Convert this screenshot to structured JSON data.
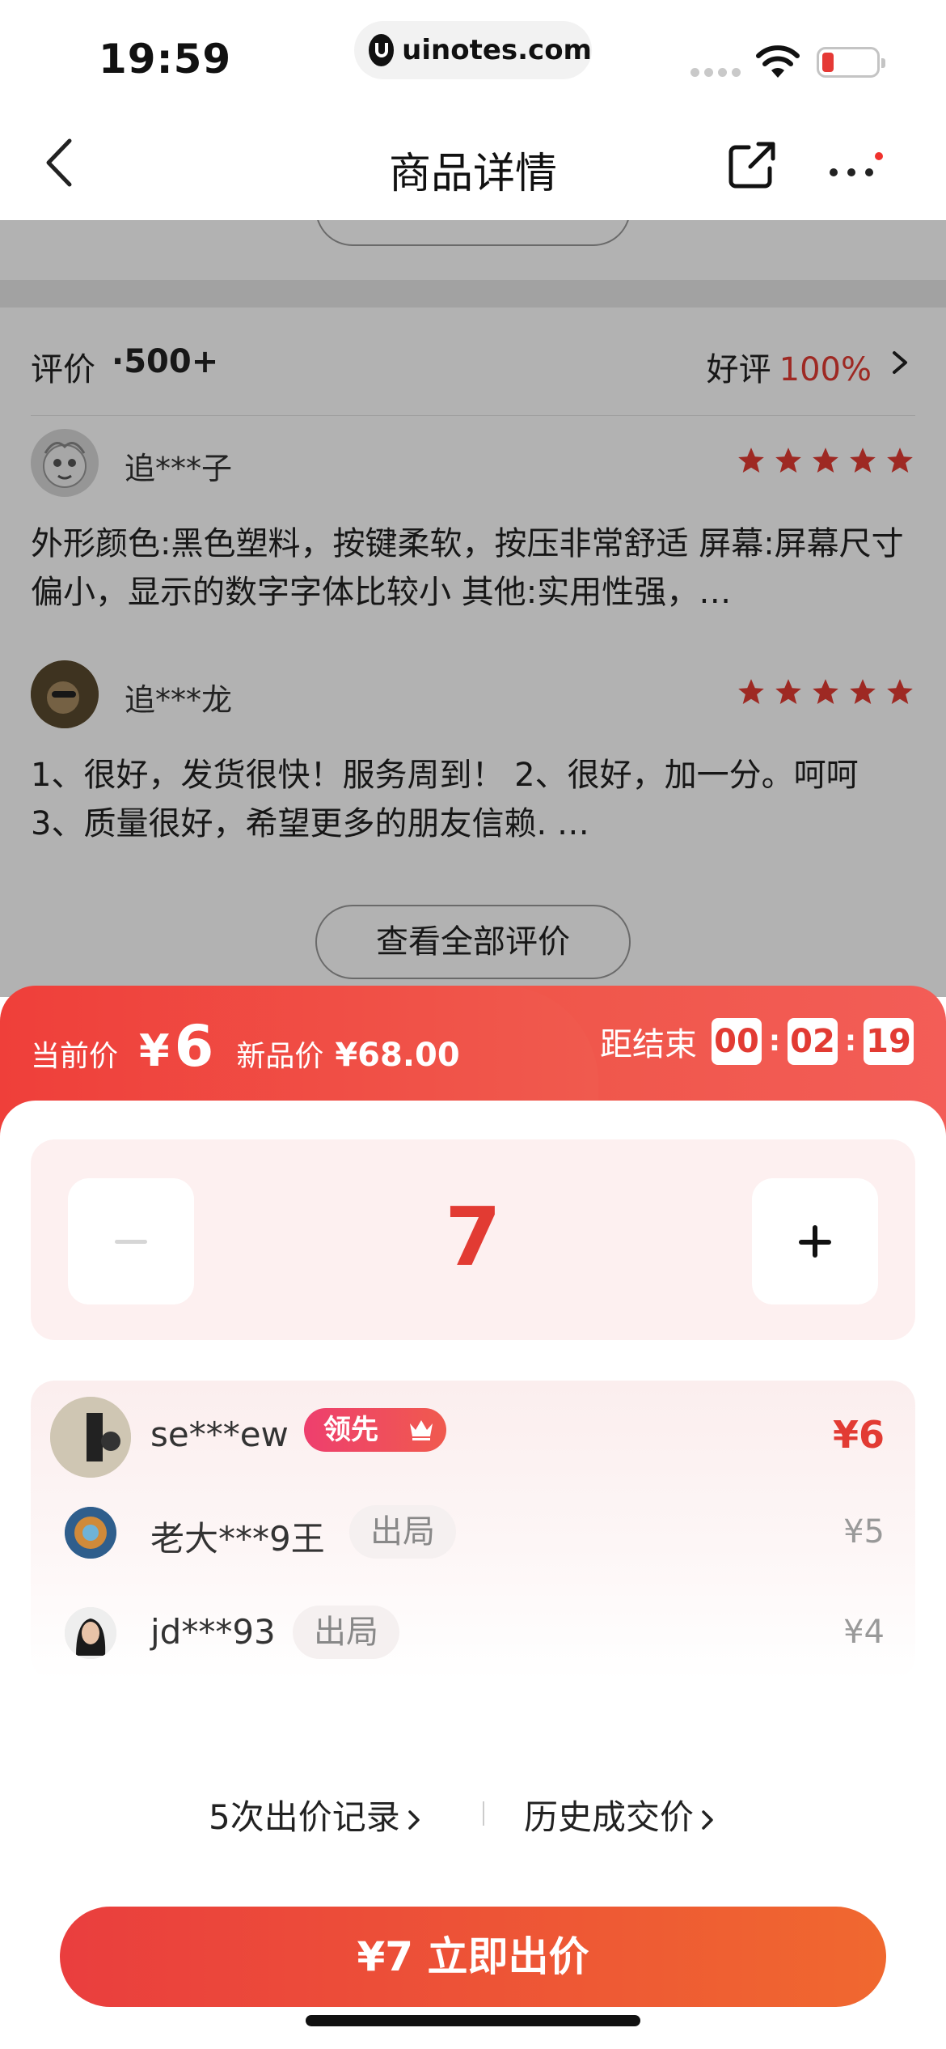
{
  "status_bar": {
    "time": "19:59",
    "url": "uinotes.com"
  },
  "nav": {
    "title": "商品详情",
    "back_icon": "chevron-left-icon",
    "share_icon": "share-icon",
    "more_icon": "more-dots-icon"
  },
  "background": {
    "reviews_header": {
      "label": "评价",
      "count": "·500+",
      "good_label": "好评",
      "good_rate": "100%"
    },
    "reviews": [
      {
        "user": "追***子",
        "stars": 5,
        "text": "外形颜色:黑色塑料，按键柔软，按压非常舒适 屏幕:屏幕尺寸偏小，显示的数字字体比较小 其他:实用性强，…"
      },
      {
        "user": "追***龙",
        "stars": 5,
        "text": "1、很好，发货很快！服务周到！        2、很好，加一分。呵呵       3、质量很好，希望更多的朋友信赖.   …"
      }
    ],
    "all_reviews_button": "查看全部评价",
    "colors": {
      "star": "#e23b33",
      "accent": "#e23b33"
    }
  },
  "bid_sheet": {
    "current_price_label": "当前价",
    "currency": "¥",
    "current_price": "6",
    "new_price_label": "新品价",
    "new_price": "¥68.00",
    "countdown_label": "距结束",
    "countdown": {
      "h": "00",
      "m": "02",
      "s": "19"
    },
    "stepper": {
      "value": "7",
      "minus_icon": "minus-icon",
      "plus_icon": "plus-icon"
    },
    "bids": [
      {
        "user": "se***ew",
        "badge": "领先",
        "badge_icon": "crown-icon",
        "amount": "¥6"
      },
      {
        "user": "老大***9王",
        "badge": "出局",
        "amount": "¥5"
      },
      {
        "user": "jd***93",
        "badge": "出局",
        "amount": "¥4"
      }
    ],
    "bid_records_link": "5次出价记录",
    "history_price_link": "历史成交价",
    "submit_button": "¥7 立即出价",
    "colors": {
      "header_gradient_start": "#ef3f3a",
      "header_gradient_end": "#f35d57",
      "button_start": "#ea3e3e",
      "button_end": "#f0682f"
    }
  }
}
